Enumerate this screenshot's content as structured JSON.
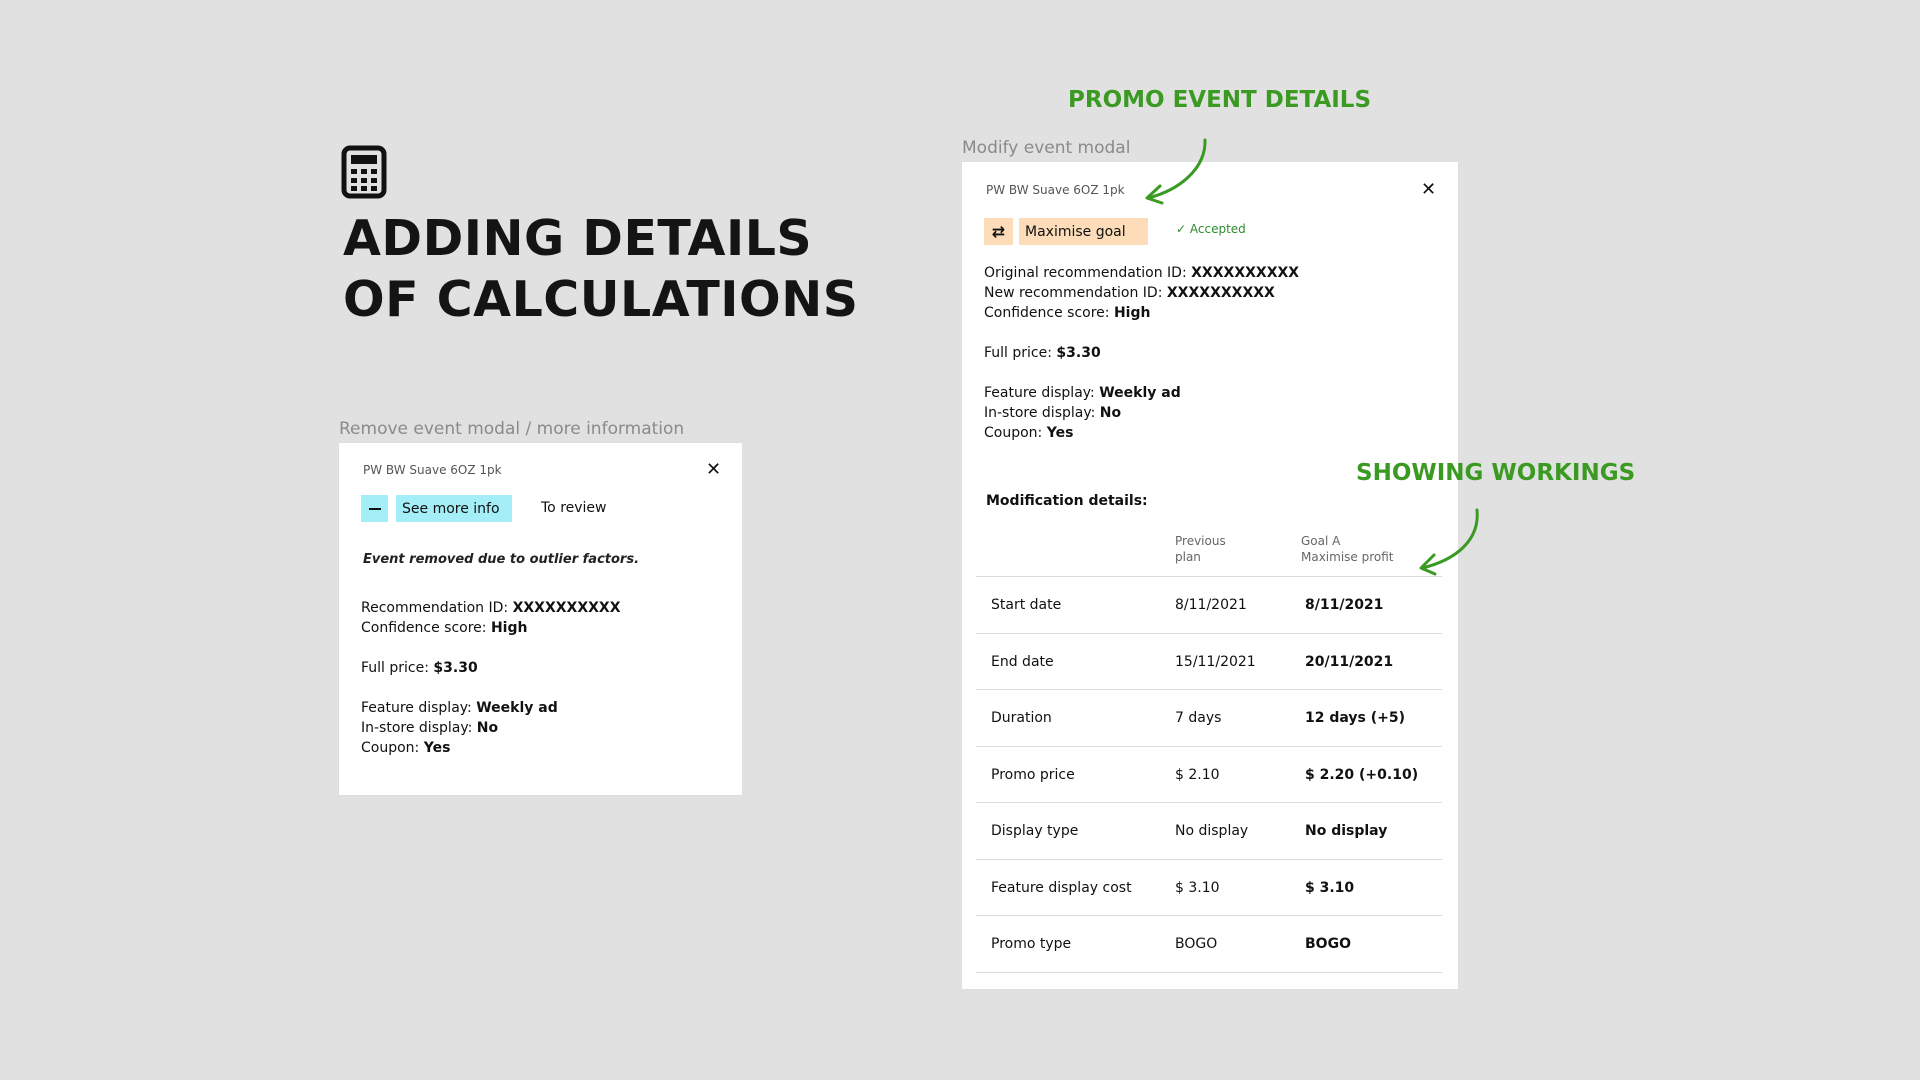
{
  "heading": {
    "line1": "ADDING DETAILS",
    "line2": "OF CALCULATIONS",
    "icon": "calculator-icon"
  },
  "left_frame": {
    "label": "Remove event modal / more information",
    "product": "PW BW Suave 6OZ 1pk",
    "see_more_label": "See more info",
    "status_label": "To review",
    "reason": "Event removed due to outlier factors.",
    "fields": {
      "rec_id_label": "Recommendation ID:",
      "rec_id_value": "XXXXXXXXXX",
      "conf_label": "Confidence score:",
      "conf_value": "High",
      "price_label": "Full price:",
      "price_value": "$3.30",
      "feature_label": "Feature display:",
      "feature_value": "Weekly ad",
      "instore_label": "In-store display:",
      "instore_value": "No",
      "coupon_label": "Coupon:",
      "coupon_value": "Yes"
    }
  },
  "right_frame": {
    "label": "Modify event modal",
    "product": "PW BW Suave 6OZ 1pk",
    "goal_label": "Maximise goal",
    "accepted_label": "Accepted",
    "fields": {
      "orig_id_label": "Original recommendation ID:",
      "orig_id_value": "XXXXXXXXXX",
      "new_id_label": "New recommendation ID:",
      "new_id_value": "XXXXXXXXXX",
      "conf_label": "Confidence score:",
      "conf_value": "High",
      "price_label": "Full price:",
      "price_value": "$3.30",
      "feature_label": "Feature display:",
      "feature_value": "Weekly ad",
      "instore_label": "In-store display:",
      "instore_value": "No",
      "coupon_label": "Coupon:",
      "coupon_value": "Yes"
    },
    "mod_title": "Modification details:",
    "col_prev_1": "Previous",
    "col_prev_2": "plan",
    "col_goal_1": "Goal A",
    "col_goal_2": "Maximise profit",
    "rows": [
      {
        "label": "Start date",
        "prev": "8/11/2021",
        "goal": "8/11/2021"
      },
      {
        "label": "End date",
        "prev": "15/11/2021",
        "goal": "20/11/2021"
      },
      {
        "label": "Duration",
        "prev": "7 days",
        "goal": "12 days (+5)"
      },
      {
        "label": "Promo price",
        "prev": "$ 2.10",
        "goal": "$ 2.20 (+0.10)"
      },
      {
        "label": "Display type",
        "prev": "No display",
        "goal": "No display"
      },
      {
        "label": "Feature display cost",
        "prev": "$ 3.10",
        "goal": "$ 3.10"
      },
      {
        "label": "Promo type",
        "prev": "BOGO",
        "goal": "BOGO"
      }
    ]
  },
  "annotations": {
    "promo": "PROMO EVENT DETAILS",
    "workings": "SHOWING WORKINGS",
    "color": "#3a9a22"
  }
}
